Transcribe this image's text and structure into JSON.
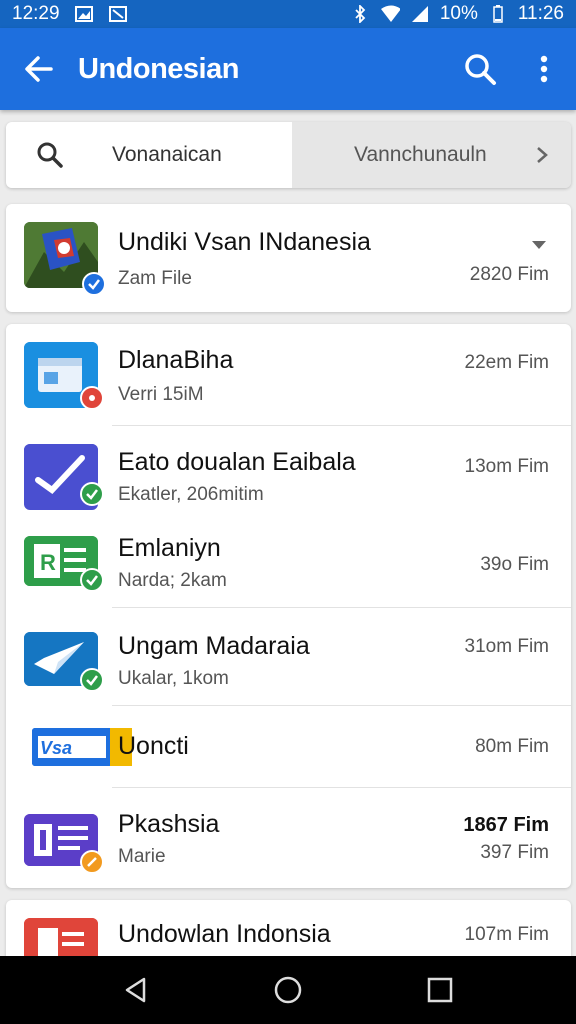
{
  "status_bar": {
    "time_left": "12:29",
    "battery": "10%",
    "time_right": "11:26"
  },
  "app_bar": {
    "title": "Undonesian"
  },
  "tabs": {
    "left_label": "Vonanaican",
    "right_label": "Vannchunauln"
  },
  "header_item": {
    "title": "Undiki Vsan INdanesia",
    "subtitle": "Zam File",
    "size": "2820 Fim"
  },
  "items": [
    {
      "title": "DlanaBiha",
      "subtitle": "Verri 15iM",
      "size": "22em Fim",
      "icon": "window-app-icon"
    },
    {
      "title": "Eato doualan Eaibala",
      "subtitle": "Ekatler, 206mitim",
      "size": "13om Fim",
      "icon": "check-document-icon"
    },
    {
      "title": "Emlaniyn",
      "subtitle": "Narda; 2kam",
      "size": "39o Fim",
      "icon": "spreadsheet-icon"
    },
    {
      "title": "Ungam Madaraia",
      "subtitle": "Ukalar, 1kom",
      "size": "31om Fim",
      "icon": "send-doc-icon"
    },
    {
      "title": "Uoncti",
      "subtitle": "",
      "size": "80m Fim",
      "icon": "vsa-card-icon"
    },
    {
      "title": "Pkashsia",
      "subtitle": "Marie",
      "size": "1867 Fim",
      "size2": "397 Fim",
      "icon": "forms-icon"
    }
  ],
  "footer_item": {
    "title": "Undowlan Indonsia",
    "size": "107m Fim"
  },
  "colors": {
    "primary": "#1e6fde",
    "status": "#1565c0",
    "accent_green": "#2e9e4a",
    "accent_red": "#e0453a"
  },
  "vsa_icon_text": "Vsa"
}
